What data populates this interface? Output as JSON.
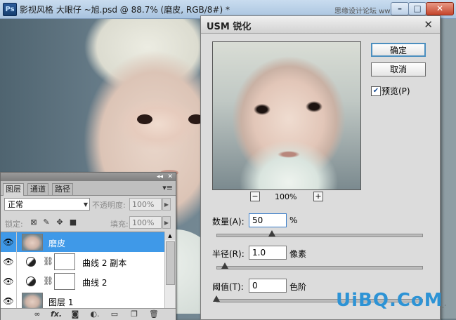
{
  "window": {
    "app_icon": "Ps",
    "title": "影视风格 大眼仔 ~旭.psd @ 88.7% (磨皮, RGB/8#) *",
    "forum_text": "思缘设计论坛 www.MISSYUAN.COM"
  },
  "layers_panel": {
    "tabs": [
      "图层",
      "通道",
      "路径"
    ],
    "active_tab": "图层",
    "panel_arrows": "◂◂",
    "menu_icon": "▾≡",
    "blend_mode": "正常",
    "opacity_label": "不透明度:",
    "opacity_value": "100%",
    "lock_label": "锁定:",
    "fill_label": "填充:",
    "fill_value": "100%",
    "layers": [
      {
        "name": "磨皮",
        "type": "pixel",
        "selected": true
      },
      {
        "name": "曲线 2 副本",
        "type": "adjustment",
        "selected": false
      },
      {
        "name": "曲线 2",
        "type": "adjustment",
        "selected": false
      },
      {
        "name": "图层 1",
        "type": "pixel",
        "selected": false
      }
    ],
    "bottom_icons": [
      "link-icon",
      "fx-icon",
      "mask-icon",
      "adjustment-icon",
      "group-icon",
      "new-layer-icon",
      "trash-icon"
    ]
  },
  "usm_dialog": {
    "title": "USM 锐化",
    "ok_label": "确定",
    "cancel_label": "取消",
    "preview_label": "预览(P)",
    "preview_checked": true,
    "zoom_minus": "−",
    "zoom_plus": "+",
    "zoom_level": "100%",
    "amount": {
      "label": "数量(A):",
      "value": "50",
      "unit": "%",
      "slider_fraction": 0.27
    },
    "radius": {
      "label": "半径(R):",
      "value": "1.0",
      "unit": "像素",
      "slider_fraction": 0.04
    },
    "threshold": {
      "label": "阈值(T):",
      "value": "0",
      "unit": "色阶",
      "slider_fraction": 0.0
    }
  },
  "watermark": "UiBQ.CoM"
}
